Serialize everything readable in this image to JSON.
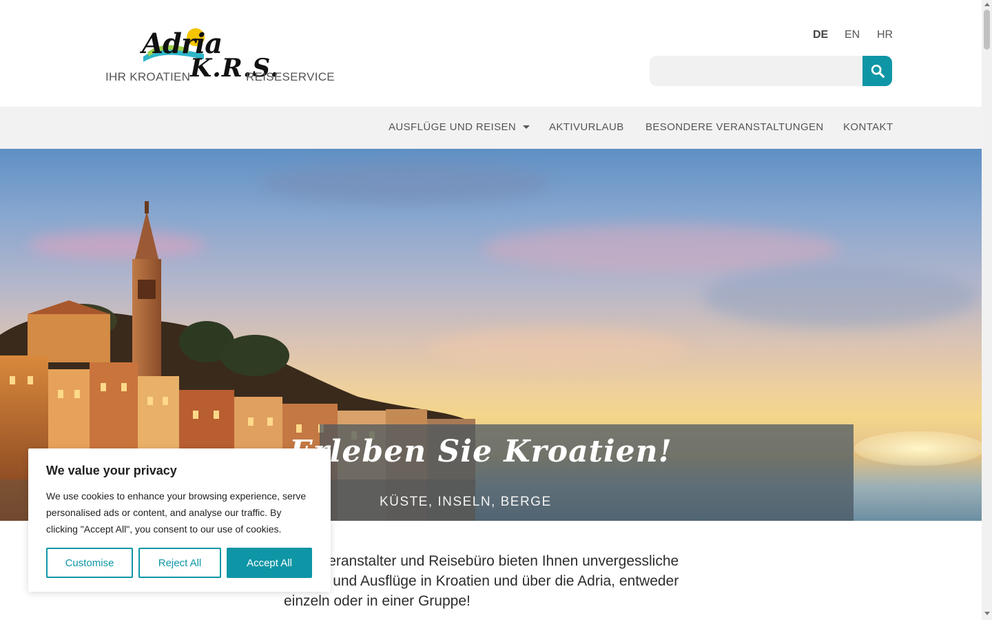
{
  "header": {
    "logo": {
      "wordmark": "Adria",
      "initials": "K.R.S.",
      "tagline_left": "IHR KROATIEN",
      "tagline_right": "REISESERVICE"
    },
    "languages": [
      {
        "label": "DE",
        "active": true
      },
      {
        "label": "EN",
        "active": false
      },
      {
        "label": "HR",
        "active": false
      }
    ],
    "search": {
      "placeholder": "",
      "value": "",
      "button_icon": "search-icon",
      "accent": "#0f96a6"
    }
  },
  "nav": {
    "items": [
      {
        "label": "AUSFLÜGE UND REISEN",
        "has_dropdown": true
      },
      {
        "label": "AKTIVURLAUB"
      },
      {
        "label": "BESONDERE VERANSTALTUNGEN"
      },
      {
        "label": "KONTAKT"
      }
    ]
  },
  "hero": {
    "title": "Erleben Sie Kroatien!",
    "subtitle": "KÜSTE, INSELN, BERGE"
  },
  "intro": {
    "text": "Reiseveranstalter und Reisebüro bieten Ihnen unvergessliche Reisen und Ausflüge in Kroatien und über die Adria, entweder einzeln oder in einer Gruppe!"
  },
  "cookie_banner": {
    "title": "We value your privacy",
    "text": "We use cookies to enhance your browsing experience, serve personalised ads or content, and analyse our traffic. By clicking \"Accept All\", you consent to our use of cookies.",
    "buttons": {
      "customise": "Customise",
      "reject": "Reject All",
      "accept": "Accept All"
    }
  }
}
